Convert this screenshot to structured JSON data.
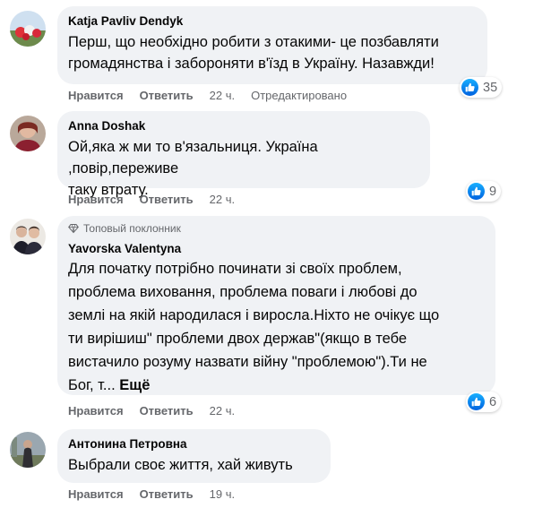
{
  "colors": {
    "bubble": "#f0f2f5",
    "secondary_text": "#65676b",
    "like_blue": "#1877f2"
  },
  "comments": [
    {
      "author": "Katja Pavliv Dendyk",
      "text_lines": [
        "Перш, що необхідно робити з отакими- це позбавляти",
        "громадянства і забороняти в'їзд в Україну. Назавжди!"
      ],
      "like_label": "Нравится",
      "reply_label": "Ответить",
      "time": "22 ч.",
      "edited": "Отредактировано",
      "reactions": "35"
    },
    {
      "author": "Anna Doshak",
      "text_lines": [
        "Ой,яка ж ми то в'язальниця. Україна ,повір,переживе",
        "таку втрату."
      ],
      "like_label": "Нравится",
      "reply_label": "Ответить",
      "time": "22 ч.",
      "reactions": "9"
    },
    {
      "badge": "Топовый поклонник",
      "author": "Yavorska Valentyna",
      "text_lines": [
        "Для початку потрібно починати зі своїх проблем,",
        "проблема виховання, проблема поваги і любові до",
        "землі на якій народилася і виросла.Ніхто не очікує що",
        "ти вирішиш\" проблеми двох держав\"(якщо в тебе",
        "вистачило розуму назвати війну \"проблемою\").Ти не"
      ],
      "text_last": "Бог, т...",
      "more_label": "Ещё",
      "like_label": "Нравится",
      "reply_label": "Ответить",
      "time": "22 ч.",
      "reactions": "6"
    },
    {
      "author": "Антонина Петровна",
      "text_lines": [
        "Выбрали своє життя, хай живуть"
      ],
      "like_label": "Нравится",
      "reply_label": "Ответить",
      "time": "19 ч."
    }
  ]
}
